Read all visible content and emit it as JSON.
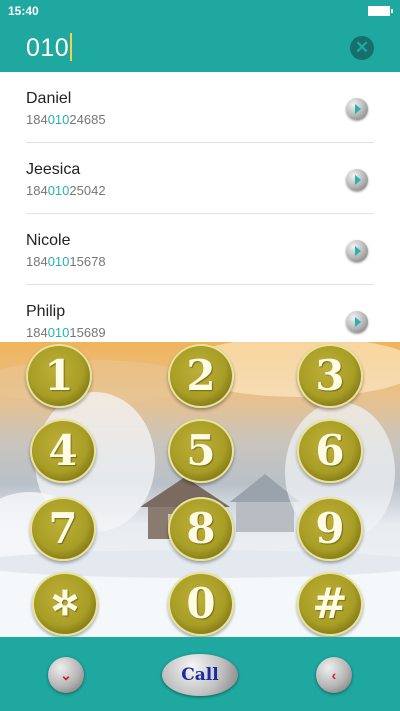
{
  "status_bar": {
    "time": "15:40"
  },
  "search": {
    "query": "010"
  },
  "contacts": [
    {
      "name": "Daniel",
      "number_prefix": "184",
      "number_match": "010",
      "number_suffix": "24685"
    },
    {
      "name": "Jeesica",
      "number_prefix": "184",
      "number_match": "010",
      "number_suffix": "25042"
    },
    {
      "name": "Nicole",
      "number_prefix": "184",
      "number_match": "010",
      "number_suffix": "15678"
    },
    {
      "name": "Philip",
      "number_prefix": "184",
      "number_match": "010",
      "number_suffix": "15689"
    }
  ],
  "keypad": {
    "keys": [
      "1",
      "2",
      "3",
      "4",
      "5",
      "6",
      "7",
      "8",
      "9",
      "✲",
      "0",
      "#"
    ]
  },
  "bottom_bar": {
    "collapse_icon": "chevron-down-icon",
    "call_label": "Call",
    "backspace_icon": "chevron-left-icon"
  },
  "colors": {
    "accent": "#1fa8a0",
    "match_highlight": "#27b3ad",
    "key_gold": "#a89d25",
    "call_text": "#1c2aa2"
  }
}
